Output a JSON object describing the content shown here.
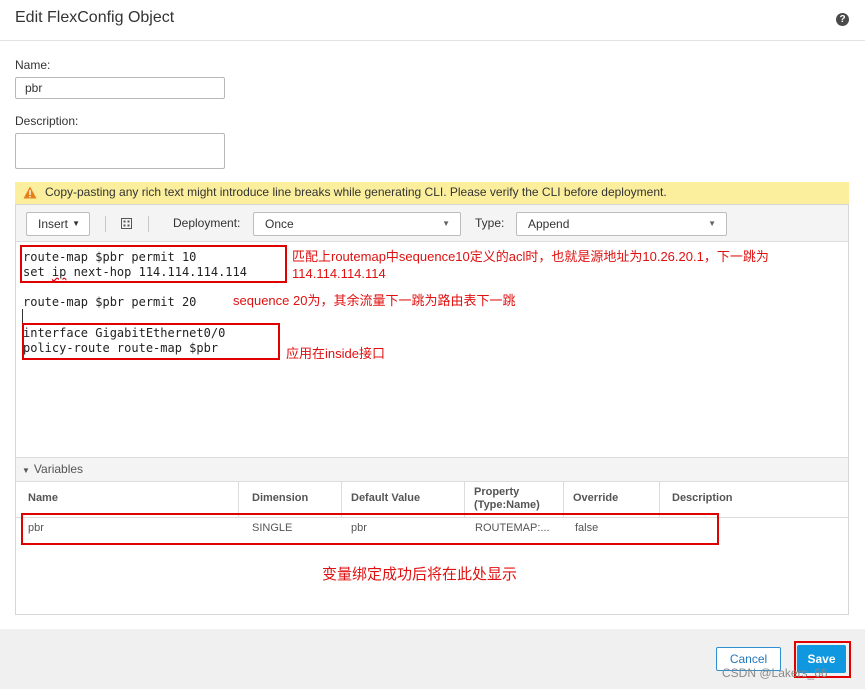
{
  "dialog": {
    "title": "Edit FlexConfig Object",
    "help_icon": "?"
  },
  "form": {
    "name_label": "Name:",
    "name_value": "pbr",
    "description_label": "Description:",
    "description_value": ""
  },
  "warning": {
    "icon": "warning-triangle-icon",
    "text": "Copy-pasting any rich text might introduce line breaks while generating CLI. Please verify the CLI before deployment."
  },
  "toolbar": {
    "insert_label": "Insert",
    "grid_icon": "grid-icon",
    "deployment_label": "Deployment:",
    "deployment_value": "Once",
    "type_label": "Type:",
    "type_value": "Append"
  },
  "editor": {
    "line1": "route-map $pbr permit 10",
    "line2_pre": "set ",
    "line2_ip": "ip",
    "line2_post": " next-hop 114.114.114.114",
    "line3": "route-map $pbr permit 20",
    "line4": "interface GigabitEthernet0/0",
    "line5": "policy-route route-map $pbr"
  },
  "annotations": {
    "note1": "匹配上routemap中sequence10定义的acl时，也就是源地址为10.26.20.1，下一跳为",
    "note1b": "114.114.114.114",
    "note2": "sequence 20为，其余流量下一跳为路由表下一跳",
    "note3": "应用在inside接口",
    "note4": "变量绑定成功后将在此处显示"
  },
  "variables": {
    "section_label": "Variables",
    "columns": {
      "name": "Name",
      "dimension": "Dimension",
      "default_value": "Default Value",
      "property1": "Property",
      "property2": "(Type:Name)",
      "override": "Override",
      "description": "Description"
    },
    "rows": [
      {
        "name": "pbr",
        "dimension": "SINGLE",
        "default_value": "pbr",
        "property": "ROUTEMAP:...",
        "override": "false",
        "description": ""
      }
    ]
  },
  "footer": {
    "cancel_label": "Cancel",
    "save_label": "Save"
  },
  "watermark": "CSDN @Lakers_66",
  "colors": {
    "annotation_red": "#e00000",
    "primary_blue": "#0f97e0",
    "warning_bg": "#fbef9e"
  }
}
